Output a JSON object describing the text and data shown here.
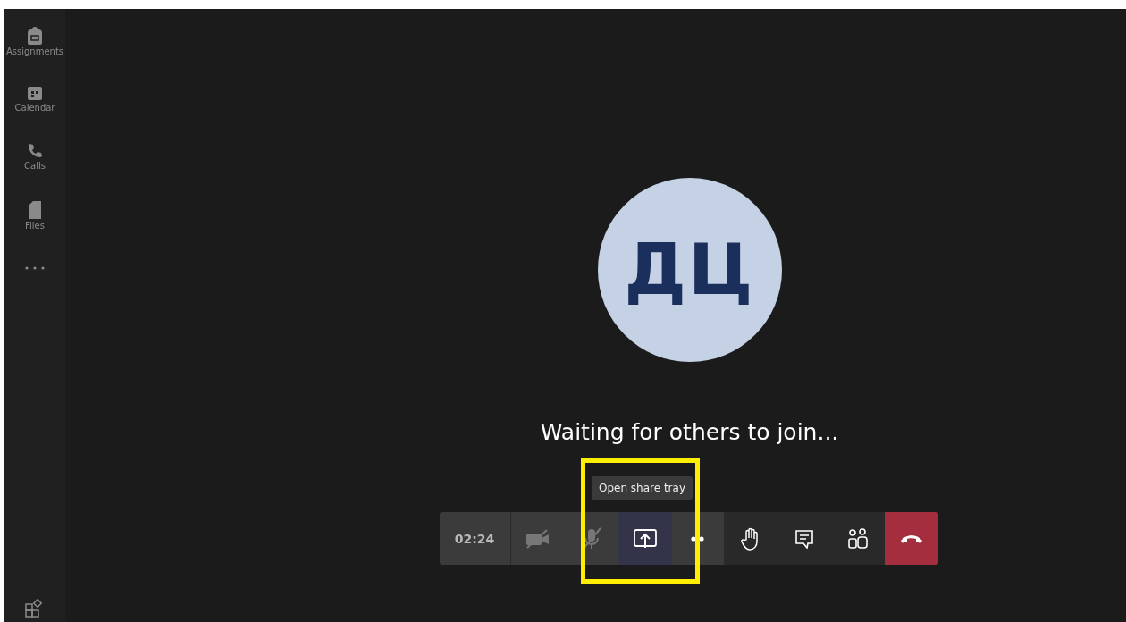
{
  "sidebar": {
    "items": [
      {
        "kind": "assignments",
        "label": "Assignments"
      },
      {
        "kind": "calendar",
        "label": "Calendar"
      },
      {
        "kind": "calls",
        "label": "Calls"
      },
      {
        "kind": "files",
        "label": "Files"
      },
      {
        "kind": "more"
      },
      {
        "kind": "apps"
      }
    ]
  },
  "call": {
    "initials": "ДЦ",
    "status": "Waiting for others to join..."
  },
  "tooltip": "Open share tray",
  "controls": [
    {
      "kind": "timer",
      "label": "02:24",
      "selected": false
    },
    {
      "kind": "camera",
      "selected": false,
      "disabled": true
    },
    {
      "kind": "mic",
      "selected": false,
      "disabled": true
    },
    {
      "kind": "share",
      "selected": true,
      "disabled": false
    },
    {
      "kind": "more",
      "selected": false,
      "disabled": false
    },
    {
      "kind": "hand",
      "selected": false,
      "disabled": false
    },
    {
      "kind": "chat",
      "selected": false,
      "disabled": false
    },
    {
      "kind": "people",
      "selected": false,
      "disabled": false
    },
    {
      "kind": "hangup",
      "selected": false,
      "disabled": false
    }
  ]
}
